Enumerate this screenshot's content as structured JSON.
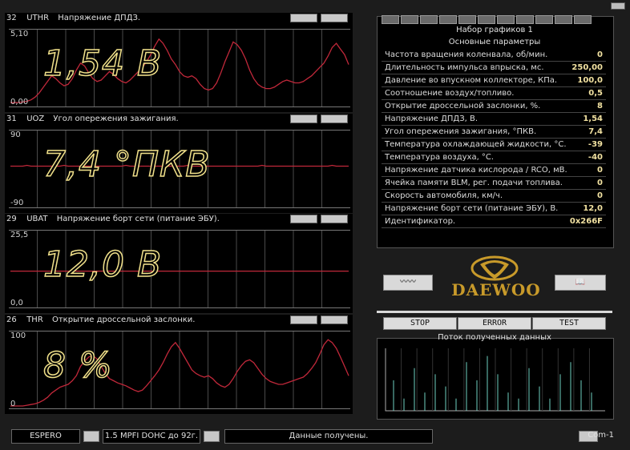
{
  "charts": [
    {
      "num": "32",
      "code": "UTHR",
      "title": "Напряжение ДПДЗ.",
      "ymax": "5,10",
      "ymin": "0,00",
      "big": "1,54 В"
    },
    {
      "num": "31",
      "code": "UOZ",
      "title": "Угол опережения зажигания.",
      "ymax": "90",
      "ymin": "-90",
      "big": "7,4 °ПКВ"
    },
    {
      "num": "29",
      "code": "UBAT",
      "title": "Напряжение борт сети (питание ЭБУ).",
      "ymax": "25,5",
      "ymin": "0,0",
      "big": "12,0 В"
    },
    {
      "num": "26",
      "code": "THR",
      "title": "Открытие дроссельной заслонки.",
      "ymax": "100",
      "ymin": "0",
      "big": "8 %"
    }
  ],
  "chart_data": [
    {
      "type": "line",
      "title": "Напряжение ДПДЗ.",
      "ylim": [
        0,
        5.1
      ],
      "series": [
        {
          "values": [
            0.1,
            0.1,
            0.12,
            0.15,
            0.2,
            0.3,
            0.5,
            0.8,
            1.2,
            1.6,
            2.0,
            1.8,
            1.5,
            1.3,
            1.4,
            1.8,
            2.4,
            2.9,
            2.7,
            2.2,
            1.8,
            1.6,
            1.7,
            2.0,
            2.3,
            2.1,
            1.8,
            1.6,
            1.5,
            1.7,
            2.0,
            2.3,
            2.6,
            3.0,
            3.5,
            4.1,
            4.6,
            4.3,
            3.8,
            3.2,
            2.8,
            2.3,
            2.0,
            1.9,
            2.0,
            1.8,
            1.4,
            1.1,
            1.0,
            1.1,
            1.5,
            2.2,
            3.0,
            3.7,
            4.4,
            4.2,
            3.8,
            3.2,
            2.4,
            1.8,
            1.4,
            1.2,
            1.1,
            1.1,
            1.2,
            1.4,
            1.6,
            1.7,
            1.6,
            1.5,
            1.5,
            1.6,
            1.8,
            2.0,
            2.3,
            2.6,
            2.9,
            3.4,
            4.0,
            4.3,
            3.9,
            3.5,
            2.8
          ]
        }
      ]
    },
    {
      "type": "line",
      "title": "Угол опережения зажигания.",
      "ylim": [
        -90,
        90
      ],
      "series": [
        {
          "values": [
            7,
            7,
            7,
            7,
            9,
            7,
            7,
            7,
            7,
            7,
            7,
            7,
            7,
            9,
            7,
            7,
            7,
            7,
            7,
            7,
            7,
            7,
            7,
            7,
            7,
            7,
            7,
            7,
            9,
            7,
            7,
            7,
            7,
            7,
            7,
            7,
            7,
            7,
            7,
            7,
            7,
            7,
            7,
            9,
            7,
            7,
            7,
            7,
            7,
            7,
            7,
            7,
            7,
            7,
            7,
            7,
            7,
            7,
            7,
            7,
            7,
            9,
            7,
            7,
            7,
            7,
            7,
            7,
            7,
            7,
            7,
            7,
            7,
            7,
            7,
            7,
            7,
            7,
            9,
            7,
            7,
            7,
            7
          ]
        }
      ]
    },
    {
      "type": "line",
      "title": "Напряжение борт сети (питание ЭБУ).",
      "ylim": [
        0,
        25.5
      ],
      "series": [
        {
          "values": [
            12.0,
            12.0,
            12.0,
            12.0,
            12.0,
            12.0,
            12.0,
            12.0,
            12.0,
            12.0,
            12.0,
            12.0,
            12.0,
            12.0,
            12.0,
            12.0,
            12.0,
            12.0,
            12.0,
            12.0,
            12.0,
            12.0,
            12.0,
            12.0,
            12.0,
            12.0,
            12.0,
            12.0,
            12.0,
            12.0,
            12.0,
            12.0,
            12.0,
            12.0,
            12.0,
            12.0,
            12.0,
            12.0,
            12.0,
            12.0,
            12.0,
            12.0,
            12.0,
            12.0,
            12.0,
            12.0,
            12.0,
            12.0,
            12.0,
            12.0,
            12.0,
            12.0,
            12.0,
            12.0,
            12.0,
            12.0,
            12.0,
            12.0,
            12.0,
            12.0,
            12.0,
            12.0,
            12.0,
            12.0,
            12.0,
            12.0,
            12.0,
            12.0,
            12.0,
            12.0,
            12.0,
            12.0,
            12.0,
            12.0,
            12.0,
            12.0,
            12.0,
            12.0,
            12.0,
            12.0,
            12.0,
            12.0,
            12.0
          ]
        }
      ]
    },
    {
      "type": "line",
      "title": "Открытие дроссельной заслонки.",
      "ylim": [
        0,
        100
      ],
      "series": [
        {
          "values": [
            0,
            0,
            0,
            0,
            1,
            2,
            3,
            5,
            8,
            12,
            18,
            22,
            26,
            28,
            30,
            35,
            42,
            55,
            62,
            68,
            70,
            65,
            55,
            45,
            38,
            35,
            32,
            30,
            28,
            25,
            22,
            20,
            22,
            28,
            35,
            42,
            50,
            60,
            72,
            82,
            88,
            80,
            70,
            60,
            50,
            45,
            42,
            40,
            42,
            38,
            32,
            28,
            26,
            30,
            38,
            48,
            56,
            62,
            64,
            60,
            52,
            44,
            38,
            34,
            32,
            30,
            30,
            32,
            34,
            36,
            38,
            40,
            45,
            52,
            60,
            72,
            85,
            92,
            88,
            80,
            68,
            55,
            42
          ]
        }
      ]
    }
  ],
  "params": {
    "title_set": "Набор графиков 1",
    "title_main": "Основные параметры",
    "rows": [
      {
        "label": "Частота вращения коленвала, об/мин.",
        "value": "0"
      },
      {
        "label": "Длительность импульса впрыска, мс.",
        "value": "250,00"
      },
      {
        "label": "Давление во впускном коллекторе, КПа.",
        "value": "100,0"
      },
      {
        "label": "Соотношение воздух/топливо.",
        "value": "0,5"
      },
      {
        "label": "Открытие дроссельной заслонки, %.",
        "value": "8"
      },
      {
        "label": "Напряжение ДПДЗ, В.",
        "value": "1,54"
      },
      {
        "label": "Угол опережения зажигания, °ПКВ.",
        "value": "7,4"
      },
      {
        "label": "Температура охлаждающей жидкости, °С.",
        "value": "-39"
      },
      {
        "label": "Температура воздуха, °С.",
        "value": "-40"
      },
      {
        "label": "Напряжение датчика кислорода / RCO, мВ.",
        "value": "0"
      },
      {
        "label": "Ячейка памяти BLM, рег. подачи топлива.",
        "value": "0"
      },
      {
        "label": "Скорость автомобиля, км/ч.",
        "value": "0"
      },
      {
        "label": "Напряжение борт сети (питание ЭБУ), В.",
        "value": "12,0"
      },
      {
        "label": "Идентификатор.",
        "value": "0x266F"
      }
    ]
  },
  "brand": "DAEWOO",
  "controls": {
    "stop": "STOP",
    "error": "ERROR",
    "test": "TEST"
  },
  "flow": {
    "title": "Поток полученных данных"
  },
  "status": {
    "model": "ESPERO",
    "engine": "1.5 MPFI DOHC до 92г.",
    "message": "Данные получены.",
    "port": "Com-1"
  },
  "colors": {
    "trace": "#c0283a",
    "value_outline": "#f0e08a",
    "value_highlight": "#f0e0a0",
    "logo": "#c89a2a",
    "flow_bar": "#6ecfc0"
  }
}
